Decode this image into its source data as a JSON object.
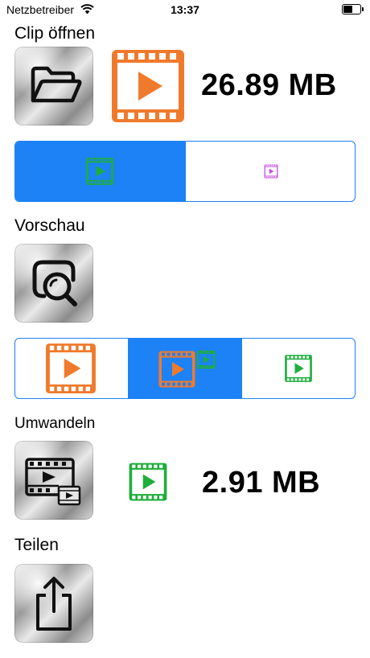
{
  "status_bar": {
    "carrier": "Netzbetreiber",
    "time": "13:37"
  },
  "open_clip": {
    "title": "Clip öffnen",
    "file_size": "26.89 MB",
    "source_segments": [
      {
        "icon": "film-play-icon-green",
        "selected": true
      },
      {
        "icon": "film-play-icon-purple",
        "selected": false
      }
    ]
  },
  "preview": {
    "title": "Vorschau",
    "segments": [
      {
        "icon": "film-play-icon-orange",
        "selected": false
      },
      {
        "icon": "film-overlay-icon",
        "selected": true
      },
      {
        "icon": "film-play-icon-green",
        "selected": false
      }
    ]
  },
  "convert": {
    "title": "Umwandeln",
    "file_size": "2.91 MB"
  },
  "share": {
    "title": "Teilen"
  },
  "colors": {
    "accent": "#1d82f5",
    "orange": "#f07a2c",
    "green": "#1fae3c",
    "purple": "#c54ee0"
  }
}
